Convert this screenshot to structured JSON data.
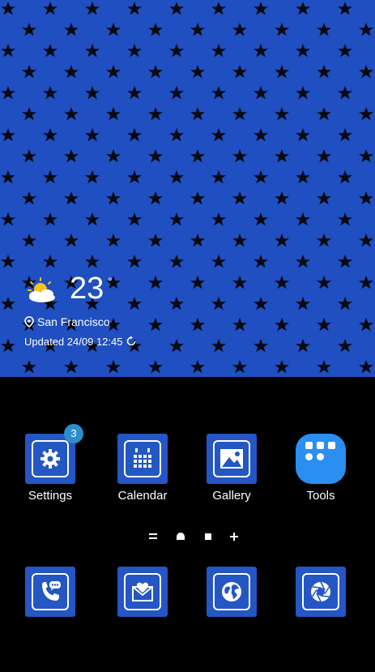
{
  "weather": {
    "temperature": "23",
    "unit": "°",
    "location": "San Francisco",
    "updated": "Updated 24/09 12:45",
    "icon": "partly-sunny-icon"
  },
  "apps": [
    {
      "label": "Settings",
      "icon": "gear-icon",
      "badge": "3"
    },
    {
      "label": "Calendar",
      "icon": "calendar-icon"
    },
    {
      "label": "Gallery",
      "icon": "picture-icon"
    },
    {
      "label": "Tools",
      "icon": "tools-folder-icon"
    }
  ],
  "dock": [
    {
      "icon": "phone-icon"
    },
    {
      "icon": "mail-icon"
    },
    {
      "icon": "globe-icon"
    },
    {
      "icon": "camera-aperture-icon"
    }
  ],
  "page_indicator": [
    "menu-icon",
    "home-page-icon",
    "page-dot-icon",
    "add-page-icon"
  ],
  "colors": {
    "wallpaper": "#1f4fc0",
    "star": "#0a0a14",
    "icon_bg": "#2456c4",
    "badge": "#2a8fcf",
    "tools_bg": "#2a8ff0"
  }
}
